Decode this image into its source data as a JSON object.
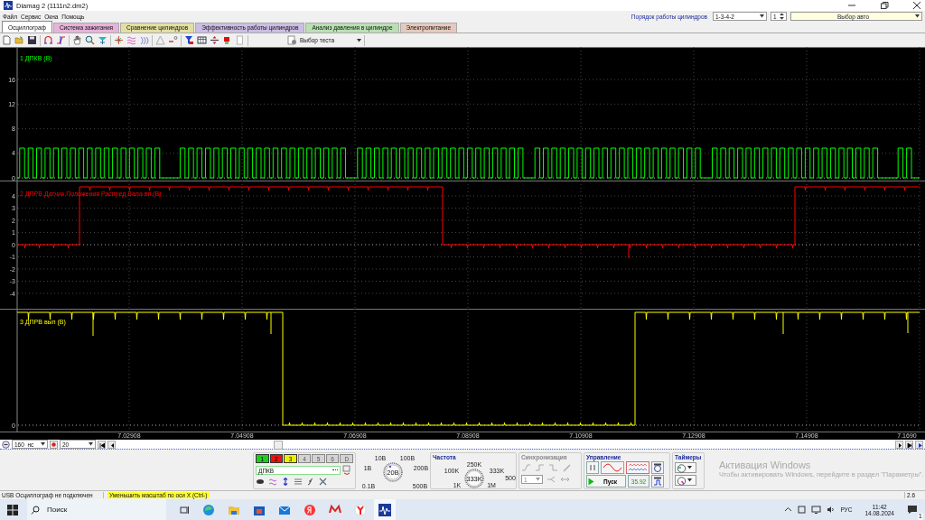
{
  "window": {
    "title": "Diamag 2 (1111n2.dm2)"
  },
  "menu": [
    "Файл",
    "Сервис",
    "Окна",
    "Помощь"
  ],
  "cylinder_order": {
    "label": "Порядок работы цилиндров",
    "value": "1-3-4-2",
    "spinner": "1"
  },
  "car_select": {
    "value": "Выбор авто"
  },
  "tabs": [
    {
      "label": "Осциллограф",
      "selected": true,
      "color": "#ffffff"
    },
    {
      "label": "Система зажигания",
      "selected": false,
      "color": "#e6b3d9"
    },
    {
      "label": "Сравнение цилиндров",
      "selected": false,
      "color": "#e3dfa3"
    },
    {
      "label": "Эффективность работы цилиндров",
      "selected": false,
      "color": "#cbbde3"
    },
    {
      "label": "Анализ давления в цилиндре",
      "selected": false,
      "color": "#b9dfb3"
    },
    {
      "label": "Электропитание",
      "selected": false,
      "color": "#e6c9bd"
    }
  ],
  "toolbar": {
    "test_select": "Выбор теста"
  },
  "channels": [
    {
      "label": "1 ДПКВ (В)",
      "color": "#00ff00",
      "yticks": [
        "16",
        "12",
        "8",
        "4",
        "0"
      ]
    },
    {
      "label": "2 ДПРВ Датчик Положения Распред Вала вп (В)",
      "color": "#ff0000",
      "yticks": [
        "4",
        "3",
        "2",
        "1",
        "0",
        "-1",
        "-2",
        "-3",
        "-4"
      ]
    },
    {
      "label": "3 ДПРВ вып (В)",
      "color": "#ffff00",
      "yticks": [
        "0"
      ]
    }
  ],
  "time_axis": [
    "7.02908",
    "7.04908",
    "7.06908",
    "7.08908",
    "7.10908",
    "7.12908",
    "7.14908",
    "7.1690"
  ],
  "timebase": {
    "value": "160",
    "unit": "нс",
    "count": "20"
  },
  "channel_buttons": [
    {
      "label": "1",
      "on": true,
      "color": "#22cc22"
    },
    {
      "label": "2",
      "on": true,
      "color": "#ee1111"
    },
    {
      "label": "3",
      "on": true,
      "color": "#eeee00"
    },
    {
      "label": "4",
      "on": false
    },
    {
      "label": "5",
      "on": false
    },
    {
      "label": "6",
      "on": false
    },
    {
      "label": "D",
      "on": false
    }
  ],
  "channel_field": {
    "value": "ДПКВ"
  },
  "voltage_dial": {
    "labels": [
      "10В",
      "100В",
      "1В",
      "200В",
      "0.1В",
      "500В"
    ],
    "value": "20В"
  },
  "frequency": {
    "title": "Частота",
    "labels": [
      "250K",
      "100K",
      "333K",
      "500",
      "1K",
      "1M"
    ],
    "value": "333K"
  },
  "sync": {
    "title": "Синхронизация",
    "channel": "1"
  },
  "control": {
    "title": "Управление",
    "start": "Пуск",
    "reading": "35.92"
  },
  "timers": {
    "title": "Таймеры"
  },
  "activation": {
    "title": "Активация Windows",
    "text": "Чтобы активировать Windows, перейдите в раздел \"Параметры\"."
  },
  "status_bar": {
    "connection": "USB Осциллограф не подключен",
    "hint": "Уменьшить масштаб по оси Х (Ctrl-)",
    "page": "2.6"
  },
  "taskbar": {
    "search": "Поиск",
    "language": "РУС",
    "time": "11:42",
    "date": "14.08.2024",
    "notifications": "1"
  }
}
